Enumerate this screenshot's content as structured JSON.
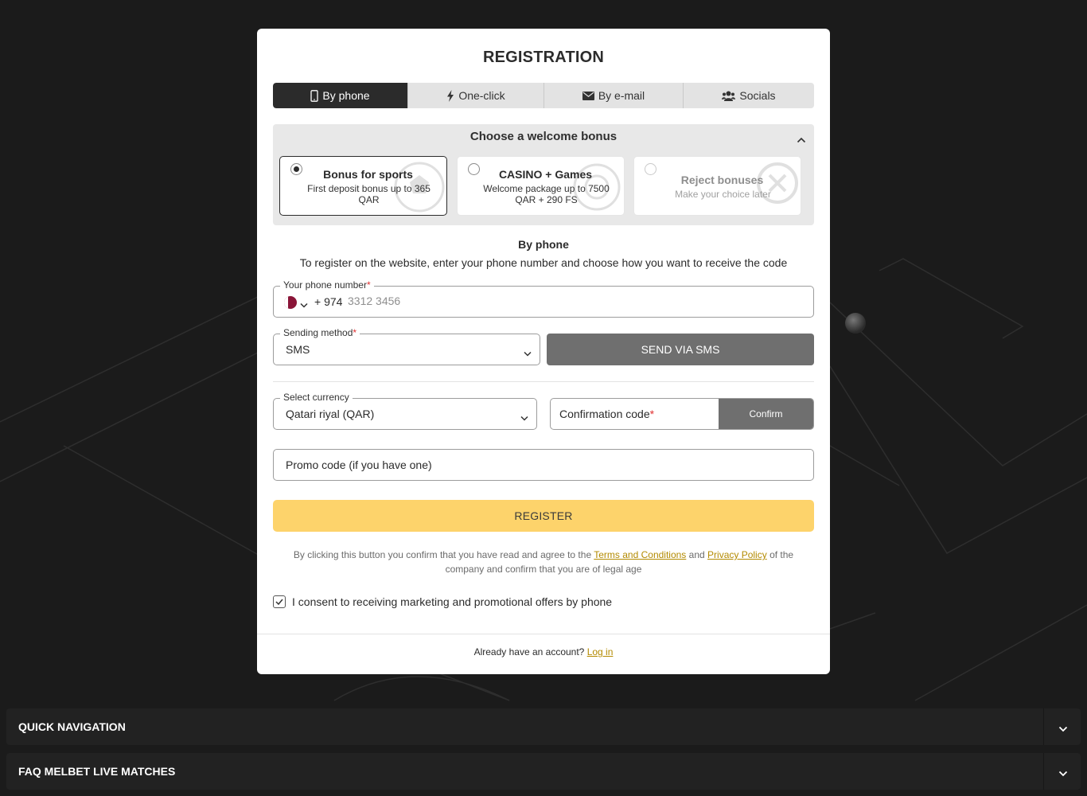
{
  "modal": {
    "title": "REGISTRATION",
    "tabs": [
      {
        "label": "By phone",
        "icon": "mobile-icon",
        "active": true
      },
      {
        "label": "One-click",
        "icon": "lightning-icon",
        "active": false
      },
      {
        "label": "By e-mail",
        "icon": "envelope-icon",
        "active": false
      },
      {
        "label": "Socials",
        "icon": "users-icon",
        "active": false
      }
    ],
    "bonus": {
      "title": "Choose a welcome bonus",
      "options": [
        {
          "title": "Bonus for sports",
          "subtitle": "First deposit bonus up to 365 QAR",
          "selected": true
        },
        {
          "title": "CASINO + Games",
          "subtitle": "Welcome package up to 7500 QAR + 290 FS",
          "selected": false
        },
        {
          "title": "Reject bonuses",
          "subtitle": "Make your choice later",
          "selected": false
        }
      ]
    },
    "section_title": "By phone",
    "section_desc": "To register on the website, enter your phone number and choose how you want to receive the code",
    "phone": {
      "label": "Your phone number",
      "required_mark": "*",
      "country_code": "+ 974",
      "placeholder": "3312 3456",
      "value": ""
    },
    "sending_method": {
      "label": "Sending method",
      "required_mark": "*",
      "value": "SMS"
    },
    "send_button": "SEND VIA SMS",
    "currency": {
      "label": "Select currency",
      "value": "Qatari riyal (QAR)"
    },
    "confirmation": {
      "label": "Confirmation code",
      "required_mark": "*",
      "button": "Confirm"
    },
    "promo": {
      "placeholder": "Promo code (if you have one)"
    },
    "register_button": "REGISTER",
    "terms": {
      "prefix": "By clicking this button you confirm that you have read and agree to the",
      "terms_link": "Terms and Conditions",
      "and": "and",
      "privacy_link": "Privacy Policy",
      "suffix": "of the company and confirm that you are of legal age"
    },
    "consent": {
      "checked": true,
      "label": "I consent to receiving marketing and promotional offers by phone"
    },
    "footer": {
      "text": "Already have an account?",
      "login_link": "Log in"
    }
  },
  "accordions": [
    {
      "title": "QUICK NAVIGATION"
    },
    {
      "title": "FAQ MELBET LIVE MATCHES"
    }
  ],
  "colors": {
    "page_bg": "#1b1b1b",
    "accent_yellow": "#fdd36b",
    "link_gold": "#b38a00",
    "dark_button": "#2b2b2b",
    "grey_button": "#6f6f6f",
    "required_red": "#e03131"
  }
}
